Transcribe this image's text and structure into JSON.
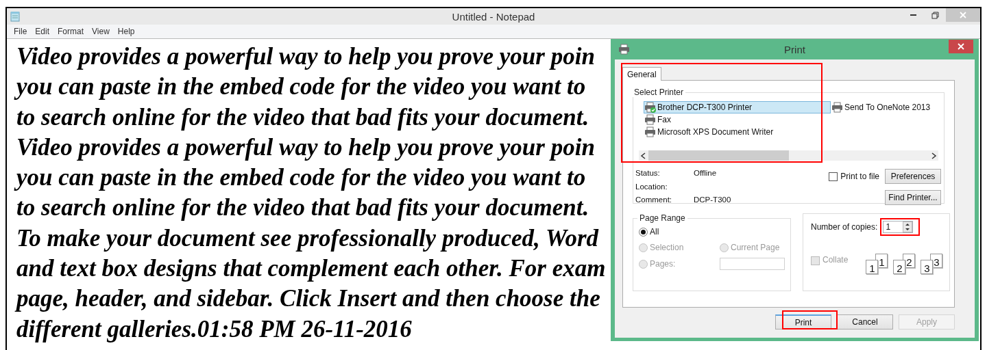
{
  "window": {
    "title": "Untitled - Notepad"
  },
  "menu": [
    "File",
    "Edit",
    "Format",
    "View",
    "Help"
  ],
  "document": {
    "lines": [
      "Video provides a powerful way to help you prove your poin",
      "you can paste in the embed code for the video you want to",
      "to search online for the video that bad fits your document.",
      "Video provides a powerful way to help you prove your poin",
      "you can paste in the embed code for the video you want to",
      "to search online for the video that bad fits your document.",
      "To make your document see professionally produced, Word",
      "and text box designs that complement each other. For exam",
      "page, header, and sidebar. Click Insert and then choose the",
      "different galleries.01:58 PM 26-11-2016"
    ]
  },
  "print_dialog": {
    "title": "Print",
    "tabs": [
      {
        "label": "General",
        "selected": true
      }
    ],
    "select_printer": {
      "label": "Select Printer",
      "printers": [
        {
          "name": "Brother DCP-T300 Printer",
          "selected": true,
          "default": true
        },
        {
          "name": "Fax",
          "selected": false,
          "default": false
        },
        {
          "name": "Microsoft XPS Document Writer",
          "selected": false,
          "default": false
        },
        {
          "name": "Send To OneNote 2013",
          "selected": false,
          "default": false
        }
      ]
    },
    "info": [
      {
        "label": "Status:",
        "value": "Offline"
      },
      {
        "label": "Location:"
      },
      {
        "label": "Comment:",
        "value": "DCP-T300"
      }
    ],
    "print_to_file": {
      "label": "Print to file",
      "checked": false
    },
    "preferences_button": "Preferences",
    "find_printer_button": "Find Printer...",
    "page_range": {
      "label": "Page Range",
      "options": [
        {
          "label": "All",
          "selected": true,
          "disabled": false
        },
        {
          "label": "Selection",
          "selected": false,
          "disabled": true
        },
        {
          "label": "Current Page",
          "selected": false,
          "disabled": true
        },
        {
          "label": "Pages:",
          "selected": false,
          "disabled": true
        }
      ]
    },
    "copies": {
      "label": "Number of copies:",
      "value": "1"
    },
    "collate": {
      "label": "Collate",
      "checked": false,
      "disabled": true
    },
    "collate_sets": [
      {
        "front": "1",
        "back": "1"
      },
      {
        "front": "2",
        "back": "2"
      },
      {
        "front": "3",
        "back": "3"
      }
    ],
    "actions": [
      {
        "label": "Print",
        "disabled": false
      },
      {
        "label": "Cancel",
        "disabled": false
      },
      {
        "label": "Apply",
        "disabled": true
      }
    ]
  }
}
